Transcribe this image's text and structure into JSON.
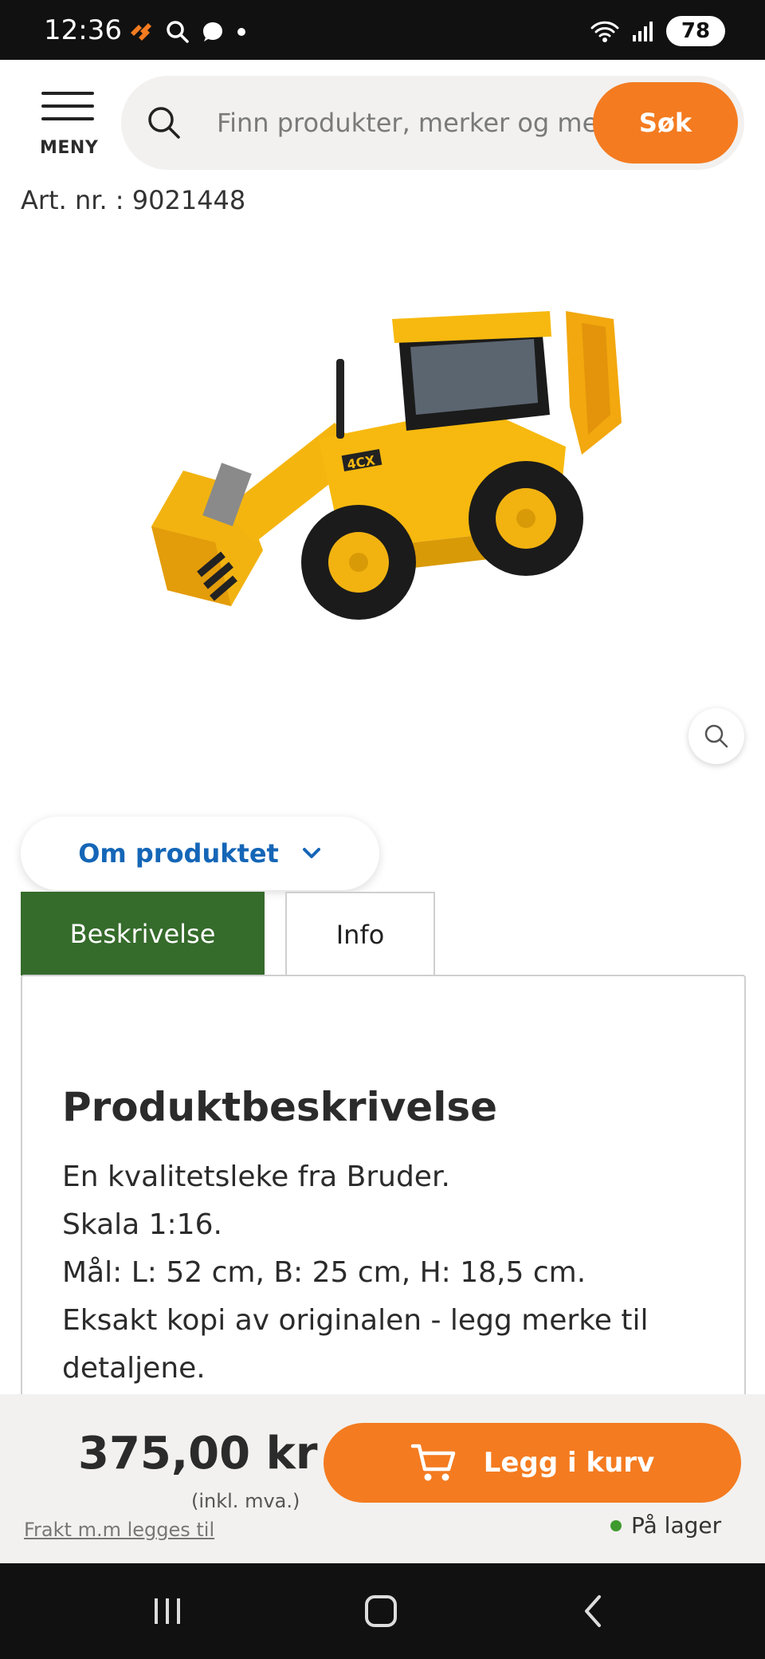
{
  "status_bar": {
    "time": "12:36",
    "battery": "78",
    "icons_left": [
      "notification-app-icon",
      "search-icon",
      "messenger-icon",
      "dot-icon"
    ],
    "icons_right": [
      "wifi-icon",
      "signal-icon",
      "battery-icon"
    ]
  },
  "header": {
    "menu_label": "MENY",
    "search_placeholder": "Finn produkter, merker og mer",
    "search_button": "Søk"
  },
  "product": {
    "art_nr": "Art. nr. : 9021448",
    "image_text": "4CX"
  },
  "about": {
    "label": "Om produktet"
  },
  "tabs": [
    {
      "label": "Beskrivelse",
      "active": true
    },
    {
      "label": "Info",
      "active": false
    }
  ],
  "description": {
    "title": "Produktbeskrivelse",
    "lines": [
      "En kvalitetsleke fra Bruder.",
      "Skala 1:16.",
      "Mål: L: 52 cm, B: 25 cm, H: 18,5 cm.",
      "Eksakt kopi av originalen - legg merke til detaljene."
    ]
  },
  "purchase": {
    "price": "375,00 kr",
    "vat_note": "(inkl. mva.)",
    "shipping_note": "Frakt m.m legges til",
    "cart_button": "Legg i kurv",
    "stock": "På lager"
  },
  "colors": {
    "accent_orange": "#f47b20",
    "tab_green": "#356b2b",
    "link_blue": "#1566b7",
    "stock_green": "#3f9a2e"
  }
}
